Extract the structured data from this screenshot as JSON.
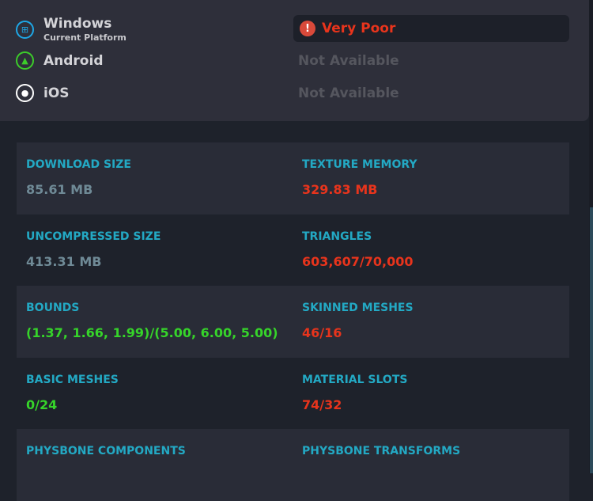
{
  "platforms": [
    {
      "name": "Windows",
      "subtitle": "Current Platform",
      "status": "Very Poor",
      "icon": "windows-icon",
      "color": "#1ea7e6"
    },
    {
      "name": "Android",
      "status": "Not Available",
      "icon": "android-icon",
      "color": "#3ccc2a"
    },
    {
      "name": "iOS",
      "status": "Not Available",
      "icon": "apple-icon",
      "color": "#ffffff"
    }
  ],
  "colors": {
    "label": "#23a9c4",
    "neutral": "#6f8a96",
    "bad": "#e8341c",
    "good": "#36d42a"
  },
  "stats": [
    [
      {
        "label": "DOWNLOAD SIZE",
        "value": "85.61 MB",
        "status": "neutral"
      },
      {
        "label": "TEXTURE MEMORY",
        "value": "329.83 MB",
        "status": "bad"
      }
    ],
    [
      {
        "label": "UNCOMPRESSED SIZE",
        "value": "413.31 MB",
        "status": "neutral"
      },
      {
        "label": "TRIANGLES",
        "value": "603,607/70,000",
        "status": "bad"
      }
    ],
    [
      {
        "label": "BOUNDS",
        "value": "(1.37, 1.66, 1.99)/(5.00, 6.00, 5.00)",
        "status": "good"
      },
      {
        "label": "SKINNED MESHES",
        "value": "46/16",
        "status": "bad"
      }
    ],
    [
      {
        "label": "BASIC MESHES",
        "value": "0/24",
        "status": "good"
      },
      {
        "label": "MATERIAL SLOTS",
        "value": "74/32",
        "status": "bad"
      }
    ],
    [
      {
        "label": "PHYSBONE COMPONENTS"
      },
      {
        "label": "PHYSBONE TRANSFORMS"
      }
    ]
  ]
}
